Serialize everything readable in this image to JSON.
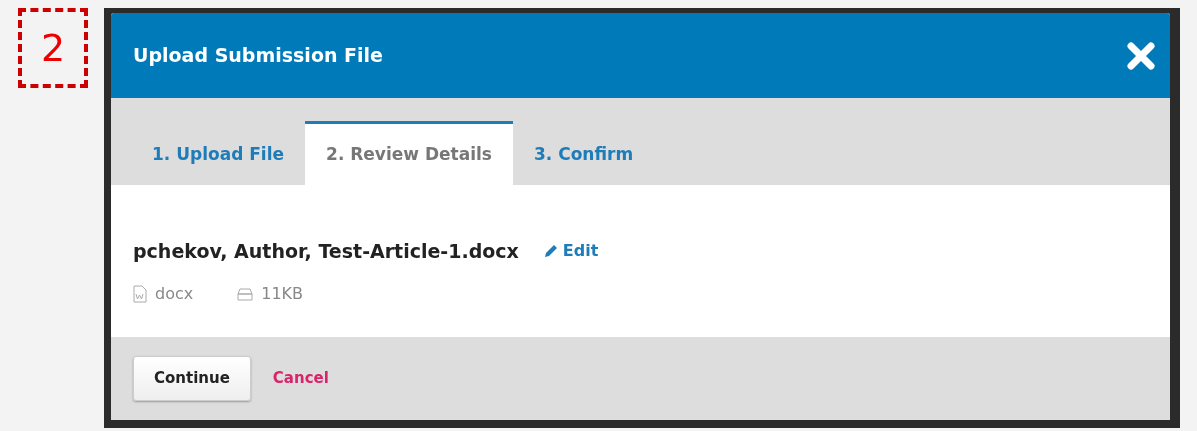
{
  "step_marker": {
    "label": "2"
  },
  "modal": {
    "title": "Upload Submission File",
    "tabs": [
      {
        "label": "1. Upload File",
        "selected": false
      },
      {
        "label": "2. Review Details",
        "selected": true
      },
      {
        "label": "3. Confirm",
        "selected": false
      }
    ],
    "file": {
      "name": "pchekov, Author, Test-Article-1.docx",
      "edit_link": "Edit",
      "type": "docx",
      "size": "11KB"
    },
    "buttons": {
      "continue": "Continue",
      "cancel": "Cancel"
    }
  }
}
